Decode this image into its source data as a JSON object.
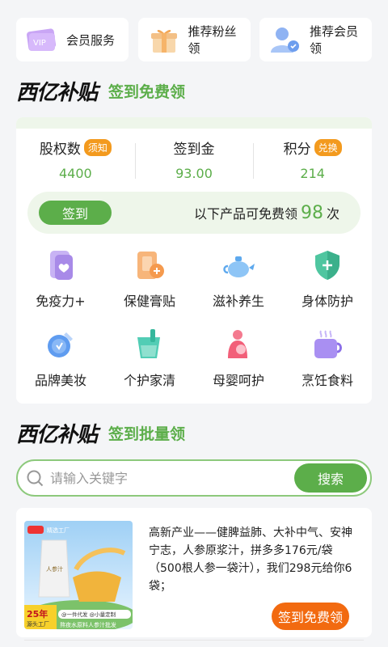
{
  "top_cards": [
    {
      "label": "会员服务",
      "icon": "vip-card-icon"
    },
    {
      "label": "推荐粉丝领",
      "icon": "gift-box-icon"
    },
    {
      "label": "推荐会员领",
      "icon": "member-user-icon"
    }
  ],
  "section1": {
    "logo": "西亿补贴",
    "title": "签到免费领"
  },
  "stats": [
    {
      "label": "股权数",
      "badge": "须知",
      "value": "4400"
    },
    {
      "label": "签到金",
      "badge": "",
      "value": "93.00"
    },
    {
      "label": "积分",
      "badge": "兑换",
      "value": "214"
    }
  ],
  "checkin": {
    "button": "签到",
    "text": "以下产品可免费领",
    "count": "98",
    "unit": "次"
  },
  "categories": [
    {
      "label": "免疫力+",
      "icon": "immunity-icon"
    },
    {
      "label": "保健膏贴",
      "icon": "plaster-icon"
    },
    {
      "label": "滋补养生",
      "icon": "teapot-icon"
    },
    {
      "label": "身体防护",
      "icon": "shield-plus-icon"
    },
    {
      "label": "品牌美妆",
      "icon": "beauty-icon"
    },
    {
      "label": "个护家清",
      "icon": "cleaning-cup-icon"
    },
    {
      "label": "母婴呵护",
      "icon": "mother-baby-icon"
    },
    {
      "label": "烹饪食料",
      "icon": "cooking-icon"
    }
  ],
  "section2": {
    "logo": "西亿补贴",
    "title": "签到批量领"
  },
  "search": {
    "placeholder": "请输入关键字",
    "button": "搜索"
  },
  "product": {
    "image_badge": "25年",
    "image_sub": "源头工厂",
    "image_brand": "精选工厂",
    "image_tag1": "@一件代发 @小量定制",
    "image_tag2": "熬夜水原料人参汁批发",
    "image_pack": "人参汁",
    "description": "高新产业——健脾益肺、大补中气、安神宁志，人参原浆汁，拼多多176元/袋（500根人参一袋汁），我们298元给你6袋；",
    "button": "签到免费领"
  },
  "colors": {
    "accent_green": "#5cae4a",
    "badge_orange": "#f39a1e",
    "claim_orange": "#f26a10"
  }
}
